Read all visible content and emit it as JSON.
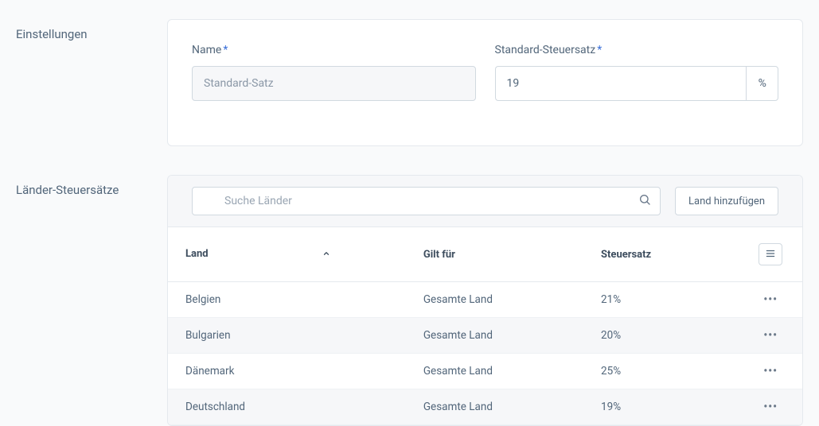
{
  "settings": {
    "section_label": "Einstellungen",
    "name_label": "Name",
    "name_value": "Standard-Satz",
    "rate_label": "Standard-Steuersatz",
    "rate_value": "19",
    "rate_unit": "%"
  },
  "countries": {
    "section_label": "Länder-Steuersätze",
    "search_placeholder": "Suche Länder",
    "add_button": "Land hinzufügen",
    "columns": {
      "country": "Land",
      "applies": "Gilt für",
      "rate": "Steuersatz"
    },
    "rows": [
      {
        "country": "Belgien",
        "applies": "Gesamte Land",
        "rate": "21%"
      },
      {
        "country": "Bulgarien",
        "applies": "Gesamte Land",
        "rate": "20%"
      },
      {
        "country": "Dänemark",
        "applies": "Gesamte Land",
        "rate": "25%"
      },
      {
        "country": "Deutschland",
        "applies": "Gesamte Land",
        "rate": "19%"
      }
    ]
  }
}
